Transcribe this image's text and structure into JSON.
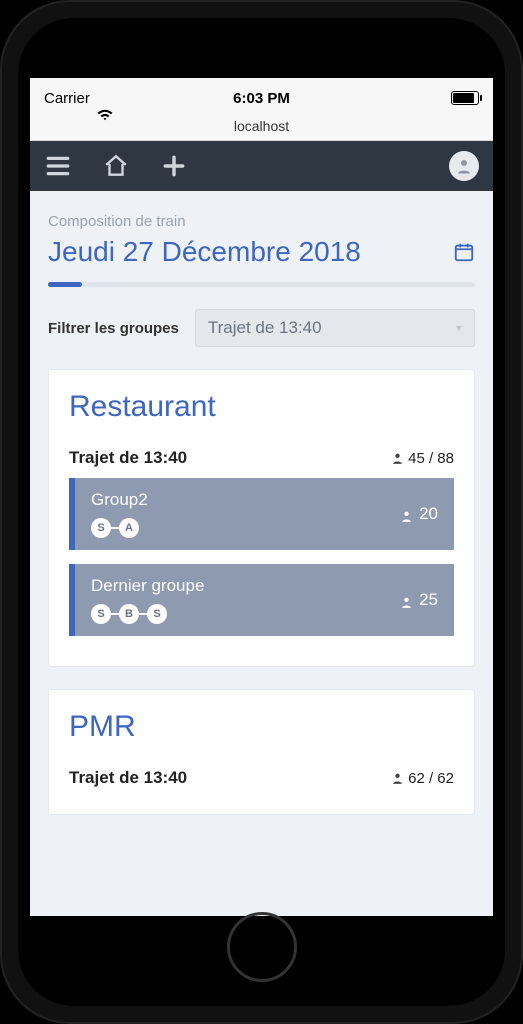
{
  "status": {
    "carrier": "Carrier",
    "time": "6:03 PM",
    "address": "localhost"
  },
  "page": {
    "subtitle": "Composition de train",
    "title": "Jeudi 27 Décembre 2018"
  },
  "filter": {
    "label": "Filtrer les groupes",
    "selected": "Trajet de 13:40"
  },
  "sections": [
    {
      "title": "Restaurant",
      "trip_label": "Trajet de 13:40",
      "count": "45 / 88",
      "groups": [
        {
          "name": "Group2",
          "chips": [
            "S",
            "A"
          ],
          "count": "20"
        },
        {
          "name": "Dernier groupe",
          "chips": [
            "S",
            "B",
            "S"
          ],
          "count": "25"
        }
      ]
    },
    {
      "title": "PMR",
      "trip_label": "Trajet de 13:40",
      "count": "62 / 62",
      "groups": []
    }
  ]
}
